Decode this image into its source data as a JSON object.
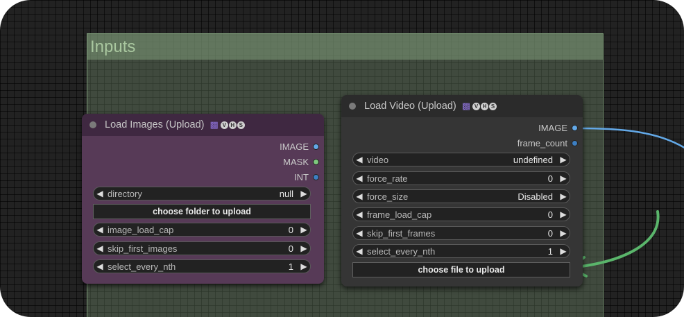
{
  "group": {
    "title": "Inputs"
  },
  "colors": {
    "image_socket": "#63a9e8",
    "mask_socket": "#7ec97e",
    "int_socket": "#3d7fc2",
    "link": "#63a9e8",
    "arrow": "#5ab56b",
    "images_node_bg": "#573a57",
    "video_node_bg": "#353535"
  },
  "images_node": {
    "title": "Load Images (Upload)",
    "badges": [
      "bot-icon",
      "V",
      "H",
      "S"
    ],
    "outputs": [
      {
        "label": "IMAGE",
        "color": "#63a9e8"
      },
      {
        "label": "MASK",
        "color": "#7ec97e"
      },
      {
        "label": "INT",
        "color": "#3d7fc2"
      }
    ],
    "directory": {
      "label": "directory",
      "value": "null"
    },
    "upload_button": "choose folder to upload",
    "widgets": [
      {
        "label": "image_load_cap",
        "value": "0"
      },
      {
        "label": "skip_first_images",
        "value": "0"
      },
      {
        "label": "select_every_nth",
        "value": "1"
      }
    ]
  },
  "video_node": {
    "title": "Load Video (Upload)",
    "badges": [
      "bot-icon",
      "V",
      "H",
      "S"
    ],
    "outputs": [
      {
        "label": "IMAGE",
        "color": "#63a9e8"
      },
      {
        "label": "frame_count",
        "color": "#3d7fc2"
      }
    ],
    "widgets": [
      {
        "label": "video",
        "value": "undefined"
      },
      {
        "label": "force_rate",
        "value": "0"
      },
      {
        "label": "force_size",
        "value": "Disabled"
      },
      {
        "label": "frame_load_cap",
        "value": "0"
      },
      {
        "label": "skip_first_frames",
        "value": "0"
      },
      {
        "label": "select_every_nth",
        "value": "1"
      }
    ],
    "upload_button": "choose file to upload"
  }
}
